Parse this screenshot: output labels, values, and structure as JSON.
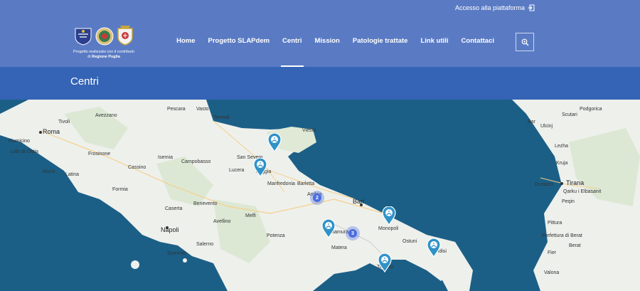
{
  "topbar": {
    "access_label": "Accesso alla piattaforma"
  },
  "branding": {
    "caption_line1": "Progetto realizzato con il contributo",
    "caption_line2_prefix": "di ",
    "caption_line2_bold": "Regione Puglia"
  },
  "nav": {
    "items": [
      {
        "label": "Home",
        "active": false
      },
      {
        "label": "Progetto SLAPdem",
        "active": false
      },
      {
        "label": "Centri",
        "active": true
      },
      {
        "label": "Mission",
        "active": false
      },
      {
        "label": "Patologie trattate",
        "active": false
      },
      {
        "label": "Link utili",
        "active": false
      },
      {
        "label": "Contattaci",
        "active": false
      }
    ],
    "search_icon": "search-icon"
  },
  "page": {
    "title": "Centri"
  },
  "map": {
    "cities": [
      {
        "name": "Roma",
        "big": true
      },
      {
        "name": "Tivoli"
      },
      {
        "name": "Avezzano"
      },
      {
        "name": "Pescara"
      },
      {
        "name": "Fiumicino"
      },
      {
        "name": "Lido di Ostia"
      },
      {
        "name": "Frosinone"
      },
      {
        "name": "Anzio"
      },
      {
        "name": "Latina"
      },
      {
        "name": "Formia"
      },
      {
        "name": "Cassino"
      },
      {
        "name": "Isernia"
      },
      {
        "name": "Campobasso"
      },
      {
        "name": "Vasto"
      },
      {
        "name": "Termoli"
      },
      {
        "name": "Caserta"
      },
      {
        "name": "Benevento"
      },
      {
        "name": "Avellino"
      },
      {
        "name": "Napoli",
        "big": true
      },
      {
        "name": "Salerno"
      },
      {
        "name": "Sorrento"
      },
      {
        "name": "Lucera"
      },
      {
        "name": "Foggia"
      },
      {
        "name": "San Severo"
      },
      {
        "name": "Manfredonia"
      },
      {
        "name": "Melfi"
      },
      {
        "name": "Potenza"
      },
      {
        "name": "Barletta"
      },
      {
        "name": "Andria"
      },
      {
        "name": "Bari",
        "big": true
      },
      {
        "name": "Altamura"
      },
      {
        "name": "Matera"
      },
      {
        "name": "Monopoli"
      },
      {
        "name": "Taranto"
      },
      {
        "name": "Brindisi"
      },
      {
        "name": "Ostuni"
      },
      {
        "name": "Vieste"
      },
      {
        "name": "Durazzo"
      },
      {
        "name": "Tirana",
        "big": true
      },
      {
        "name": "Qarku i Elbasanit"
      },
      {
        "name": "Prefettura di Berat"
      },
      {
        "name": "Podgorica"
      },
      {
        "name": "Ulcinj"
      },
      {
        "name": "Bar"
      },
      {
        "name": "Kruja"
      },
      {
        "name": "Lezha"
      },
      {
        "name": "Pittura"
      },
      {
        "name": "Peqin"
      },
      {
        "name": "Berat"
      },
      {
        "name": "Fier"
      },
      {
        "name": "Valona"
      },
      {
        "name": "Scutari"
      }
    ],
    "clusters": [
      {
        "count": "2"
      },
      {
        "count": "3"
      }
    ],
    "pin_icon": "map-pin-icon"
  }
}
